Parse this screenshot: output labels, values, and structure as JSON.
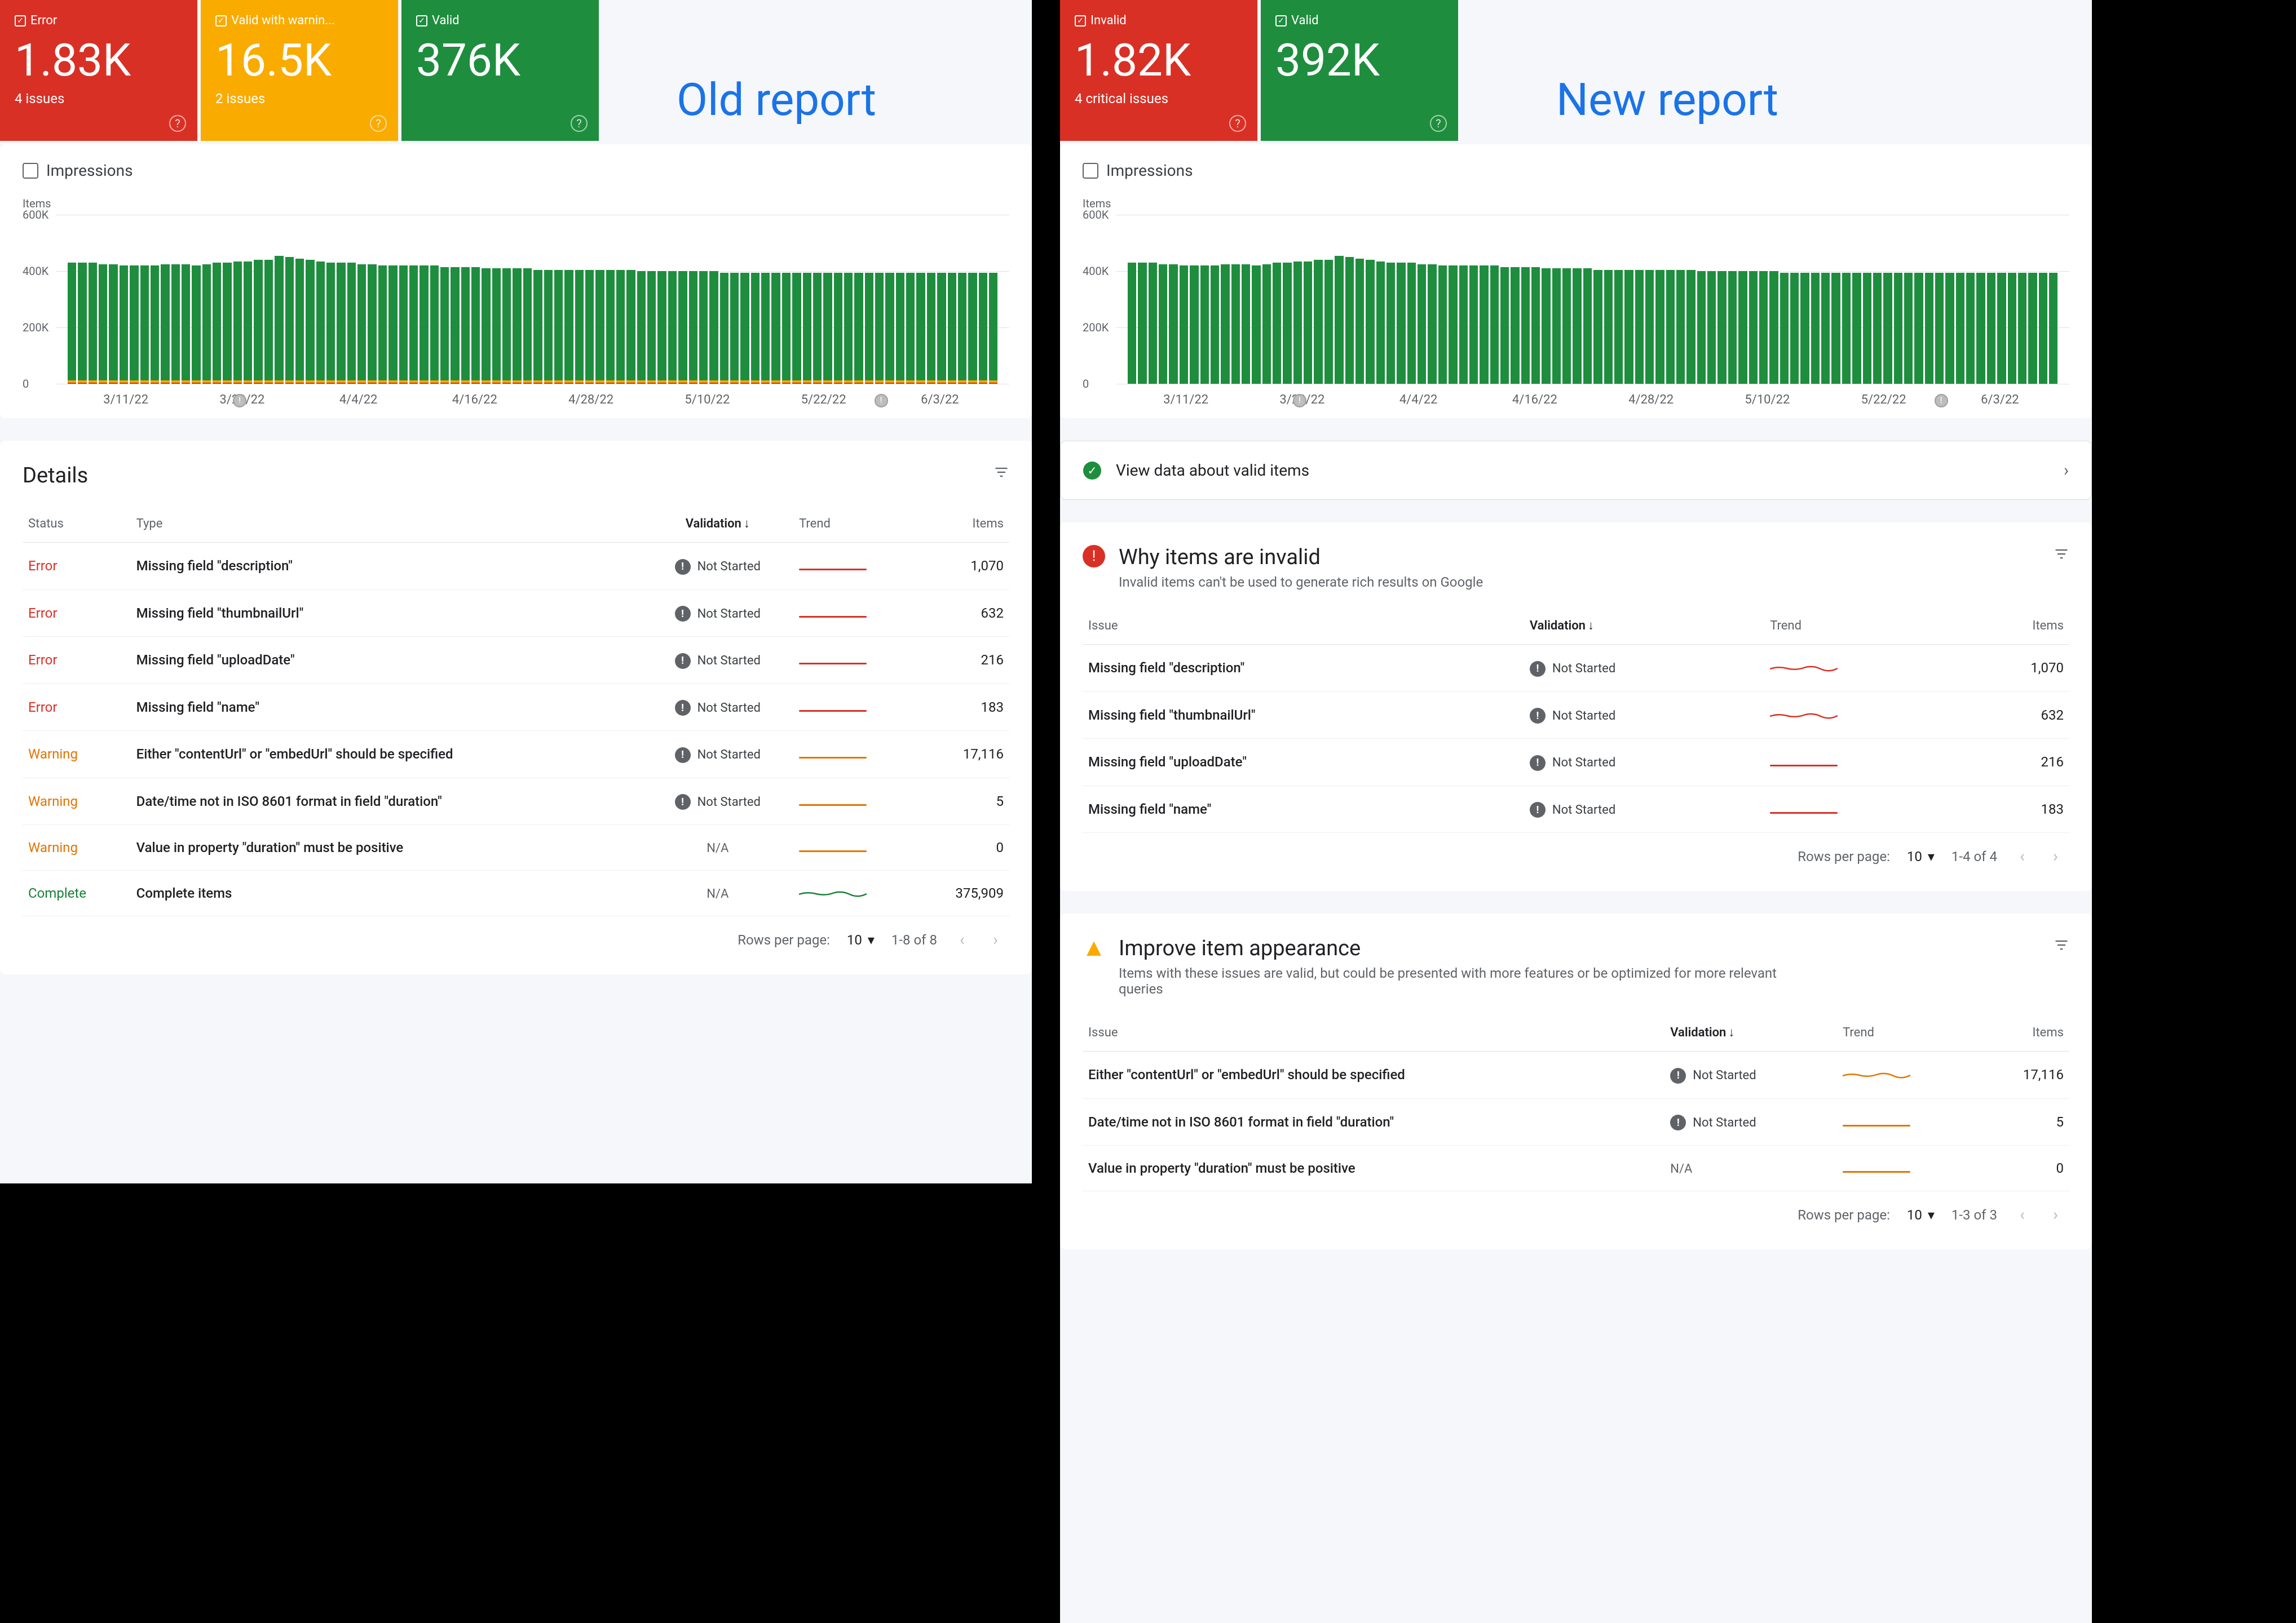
{
  "labels": {
    "old": "Old report",
    "new": "New report",
    "impressions": "Impressions",
    "items_axis": "Items",
    "rows_per_page": "Rows per page:",
    "validation": "Validation",
    "trend": "Trend",
    "items": "Items",
    "status": "Status",
    "type": "Type",
    "not_started": "Not Started",
    "na": "N/A",
    "details": "Details",
    "issue": "Issue",
    "rpp_val": "10"
  },
  "old": {
    "cards": [
      {
        "label": "Error",
        "value": "1.83K",
        "sub": "4 issues",
        "cls": "red"
      },
      {
        "label": "Valid with warnin...",
        "value": "16.5K",
        "sub": "2 issues",
        "cls": "yellow"
      },
      {
        "label": "Valid",
        "value": "376K",
        "sub": "",
        "cls": "green"
      }
    ],
    "pager": "1-8 of 8",
    "rows": [
      {
        "status": "Error",
        "scls": "err",
        "type": "Missing field \"description\"",
        "val": "badge",
        "trend": "red",
        "items": "1,070"
      },
      {
        "status": "Error",
        "scls": "err",
        "type": "Missing field \"thumbnailUrl\"",
        "val": "badge",
        "trend": "red",
        "items": "632"
      },
      {
        "status": "Error",
        "scls": "err",
        "type": "Missing field \"uploadDate\"",
        "val": "badge",
        "trend": "red",
        "items": "216"
      },
      {
        "status": "Error",
        "scls": "err",
        "type": "Missing field \"name\"",
        "val": "badge",
        "trend": "red",
        "items": "183"
      },
      {
        "status": "Warning",
        "scls": "warn",
        "type": "Either \"contentUrl\" or \"embedUrl\" should be specified",
        "val": "badge",
        "trend": "orange",
        "items": "17,116"
      },
      {
        "status": "Warning",
        "scls": "warn",
        "type": "Date/time not in ISO 8601 format in field \"duration\"",
        "val": "badge",
        "trend": "orange",
        "items": "5"
      },
      {
        "status": "Warning",
        "scls": "warn",
        "type": "Value in property \"duration\" must be positive",
        "val": "na",
        "trend": "orange",
        "items": "0"
      },
      {
        "status": "Complete",
        "scls": "ok",
        "type": "Complete items",
        "val": "na",
        "trend": "green-wavy",
        "items": "375,909"
      }
    ]
  },
  "new": {
    "cards": [
      {
        "label": "Invalid",
        "value": "1.82K",
        "sub": "4 critical issues",
        "cls": "red"
      },
      {
        "label": "Valid",
        "value": "392K",
        "sub": "",
        "cls": "green"
      }
    ],
    "valid_link": "View data about valid items",
    "invalid_title": "Why items are invalid",
    "invalid_sub": "Invalid items can't be used to generate rich results on Google",
    "invalid_pager": "1-4 of 4",
    "invalid_rows": [
      {
        "issue": "Missing field \"description\"",
        "val": "badge",
        "trend": "red-wavy",
        "items": "1,070"
      },
      {
        "issue": "Missing field \"thumbnailUrl\"",
        "val": "badge",
        "trend": "red-wavy",
        "items": "632"
      },
      {
        "issue": "Missing field \"uploadDate\"",
        "val": "badge",
        "trend": "red",
        "items": "216"
      },
      {
        "issue": "Missing field \"name\"",
        "val": "badge",
        "trend": "red",
        "items": "183"
      }
    ],
    "improve_title": "Improve item appearance",
    "improve_sub": "Items with these issues are valid, but could be presented with more features or be optimized for more relevant queries",
    "improve_pager": "1-3 of 3",
    "improve_rows": [
      {
        "issue": "Either \"contentUrl\" or \"embedUrl\" should be specified",
        "val": "badge",
        "trend": "orange-wavy",
        "items": "17,116"
      },
      {
        "issue": "Date/time not in ISO 8601 format in field \"duration\"",
        "val": "badge",
        "trend": "orange",
        "items": "5"
      },
      {
        "issue": "Value in property \"duration\" must be positive",
        "val": "na",
        "trend": "orange",
        "items": "0"
      }
    ]
  },
  "chart_data": {
    "type": "bar",
    "title": "",
    "xlabel": "",
    "ylabel": "Items",
    "ylim": [
      0,
      600000
    ],
    "yticks": [
      "0",
      "200K",
      "400K",
      "600K"
    ],
    "xticks": [
      "3/11/22",
      "3/23/22",
      "4/4/22",
      "4/16/22",
      "4/28/22",
      "5/10/22",
      "5/22/22",
      "6/3/22"
    ],
    "note": "Approximate daily valid-items count read from chart; warnings ~17K stacked (old report) below, errors ~2K at base.",
    "values_approx": [
      430,
      430,
      430,
      425,
      425,
      420,
      420,
      420,
      420,
      425,
      425,
      425,
      420,
      425,
      430,
      430,
      435,
      435,
      440,
      440,
      455,
      450,
      445,
      440,
      435,
      430,
      430,
      430,
      425,
      425,
      420,
      420,
      420,
      420,
      420,
      420,
      415,
      415,
      415,
      415,
      410,
      410,
      410,
      410,
      410,
      405,
      405,
      405,
      405,
      405,
      405,
      405,
      405,
      405,
      405,
      400,
      400,
      400,
      400,
      400,
      400,
      400,
      400,
      395,
      395,
      395,
      395,
      395,
      395,
      395,
      395,
      395,
      395,
      395,
      395,
      395,
      395,
      395,
      395,
      395,
      395,
      395,
      395,
      395,
      395,
      395,
      395,
      395,
      395,
      395
    ]
  }
}
